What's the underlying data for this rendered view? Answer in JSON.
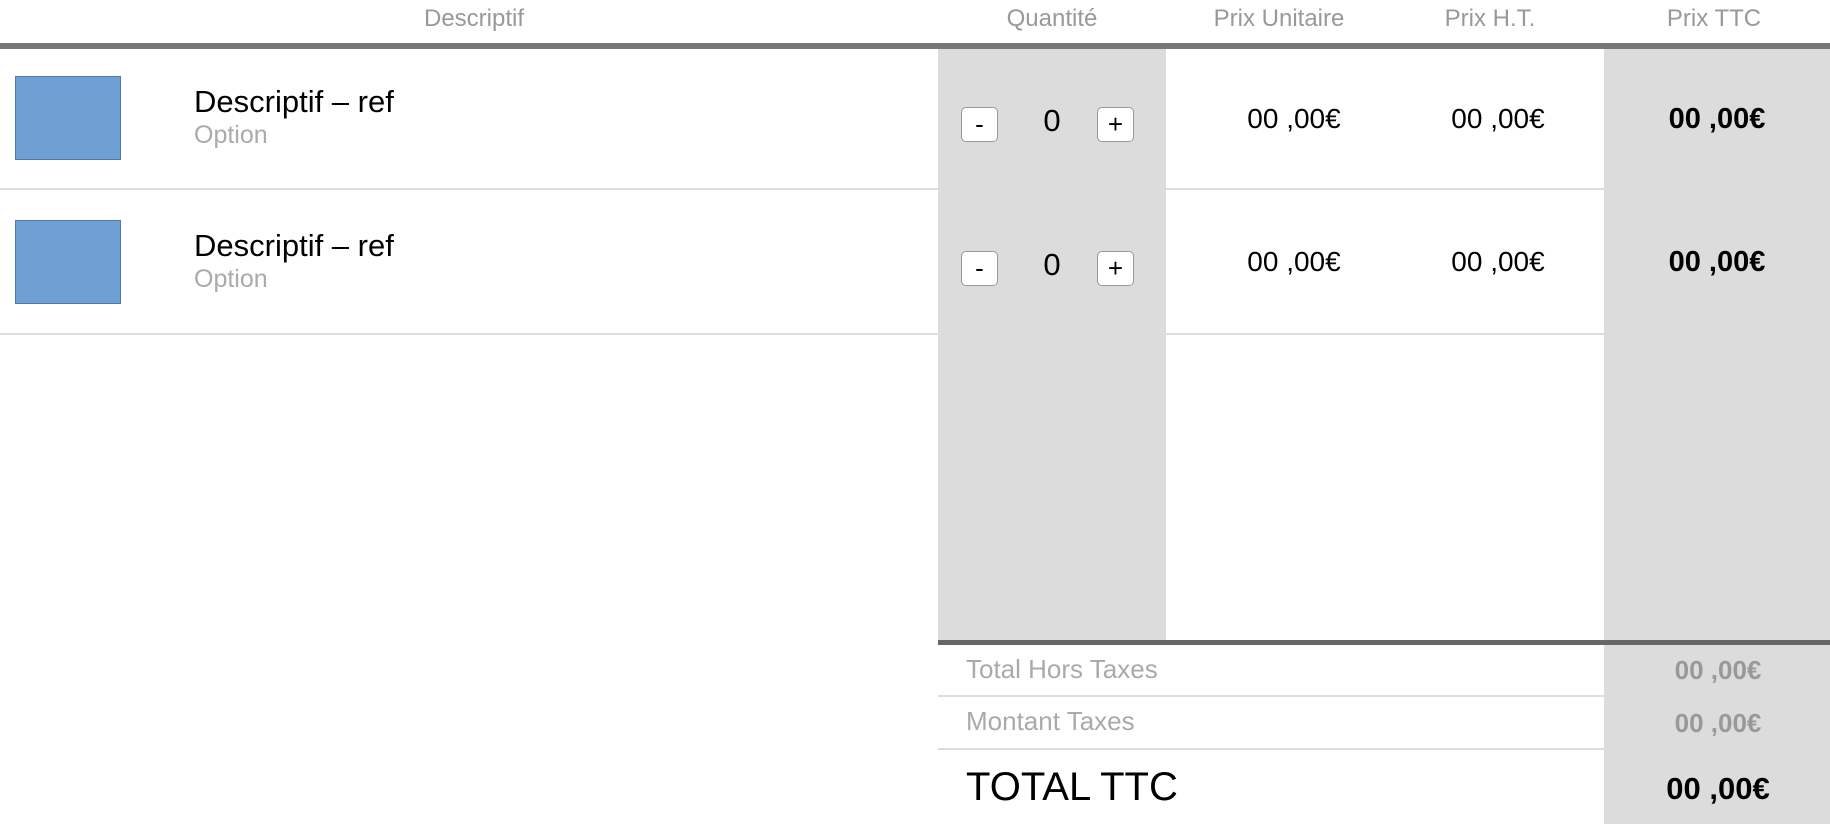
{
  "header": {
    "descriptif": "Descriptif",
    "quantite": "Quantité",
    "prix_unitaire": "Prix Unitaire",
    "prix_ht": "Prix H.T.",
    "prix_ttc": "Prix TTC"
  },
  "items": [
    {
      "title": "Descriptif – ref",
      "option": "Option",
      "minus": "-",
      "quantity": "0",
      "plus": "+",
      "unit_price": "00 ,00€",
      "price_ht": "00 ,00€",
      "price_ttc": "00 ,00€"
    },
    {
      "title": "Descriptif – ref",
      "option": "Option",
      "minus": "-",
      "quantity": "0",
      "plus": "+",
      "unit_price": "00 ,00€",
      "price_ht": "00 ,00€",
      "price_ttc": "00 ,00€"
    }
  ],
  "summary": {
    "total_ht_label": "Total Hors Taxes",
    "total_ht_value": "00 ,00€",
    "taxes_label": "Montant Taxes",
    "taxes_value": "00 ,00€",
    "total_ttc_label": "TOTAL TTC",
    "total_ttc_value": "00 ,00€"
  },
  "colors": {
    "thumbnail": "#6f9fd3",
    "column_shade": "#dcdcdc",
    "header_rule": "#777777"
  }
}
